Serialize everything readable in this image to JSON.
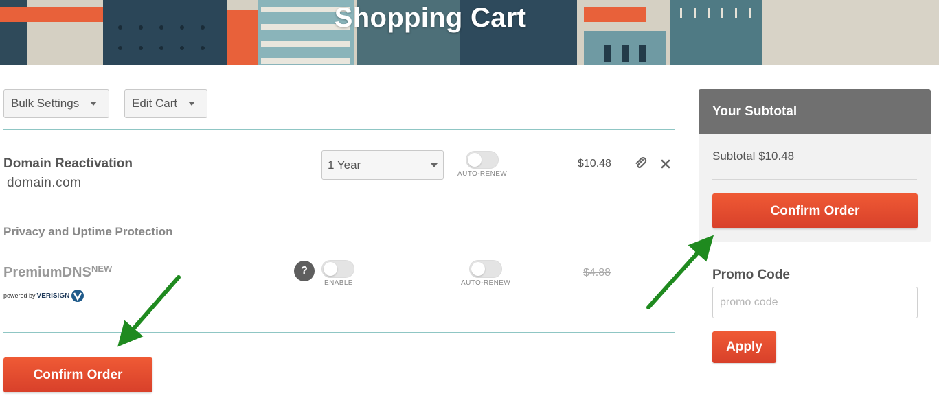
{
  "banner": {
    "title": "Shopping Cart"
  },
  "toolbar": {
    "bulk_settings_label": "Bulk Settings",
    "edit_cart_label": "Edit Cart"
  },
  "cart_item": {
    "title": "Domain Reactivation",
    "domain": "domain.com",
    "period": "1 Year",
    "auto_renew_label": "AUTO-RENEW",
    "price": "$10.48"
  },
  "protection": {
    "section_label": "Privacy and Uptime Protection",
    "product_name": "PremiumDNS",
    "new_badge": "NEW",
    "powered_by": "powered by",
    "verisign": "VERISIGN",
    "help_glyph": "?",
    "enable_label": "ENABLE",
    "auto_renew_label": "AUTO-RENEW",
    "price": "$4.88"
  },
  "confirm_label": "Confirm Order",
  "subtotal": {
    "heading": "Your Subtotal",
    "text": "Subtotal $10.48",
    "confirm_label": "Confirm Order"
  },
  "promo": {
    "label": "Promo Code",
    "placeholder": "promo code",
    "apply_label": "Apply"
  },
  "colors": {
    "accent_orange": "#e0492c",
    "divider_teal": "#8fc6c4",
    "subtotal_header": "#707070",
    "annotation_arrow": "#1f8a1f"
  },
  "icons": [
    "caret-down-icon",
    "paperclip-icon",
    "close-icon",
    "help-icon",
    "verisign-logo-icon",
    "arrow-annotation-icon"
  ]
}
